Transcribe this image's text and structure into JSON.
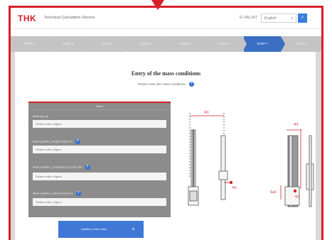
{
  "header": {
    "logo_text": "THK",
    "service_name": "Technical Calculation Service",
    "user_link": "EI VALUUT",
    "language": "English",
    "language_button": "✓"
  },
  "steps": [
    "STEP 1",
    "STEP 2",
    "STEP 3",
    "STEP 4",
    "STEP 5",
    "STEP 6",
    "STEP 7",
    "STEP 8"
  ],
  "active_step_index": 6,
  "main": {
    "title": "Entry of the mass conditions",
    "subtitle": "Please enter the mass conditions."
  },
  "form": {
    "panel_title": "Mass",
    "fields": [
      {
        "label": "Mass (m) kg",
        "placeholder": "Please enter a figure",
        "has_info": false
      },
      {
        "label": "Mass position_Height (Z)(l) mm",
        "placeholder": "Please enter a figure",
        "has_info": true
      },
      {
        "label": "Mass position_Longitudinal (X) (lb) mm",
        "placeholder": "Please enter a figure",
        "has_info": true
      },
      {
        "label": "Mass position_Lateral (Y)(l) mm",
        "placeholder": "Please enter a figure",
        "has_info": true
      }
    ],
    "submit_label": "Addition of the mass",
    "submit_icon": "+"
  },
  "diagram": {
    "labels": {
      "width_left": "Ψ1",
      "height_right": "Ψ1",
      "marker_left": "Ψ1",
      "marker_right": "Ψ1",
      "left_side": "Sa1"
    },
    "colors": {
      "accent": "#d7202b",
      "line": "#555555"
    }
  },
  "colors": {
    "brand": "#d7202b",
    "active_step": "#3a6fc4",
    "button": "#3f78d6",
    "panel": "#8c8c8c"
  }
}
